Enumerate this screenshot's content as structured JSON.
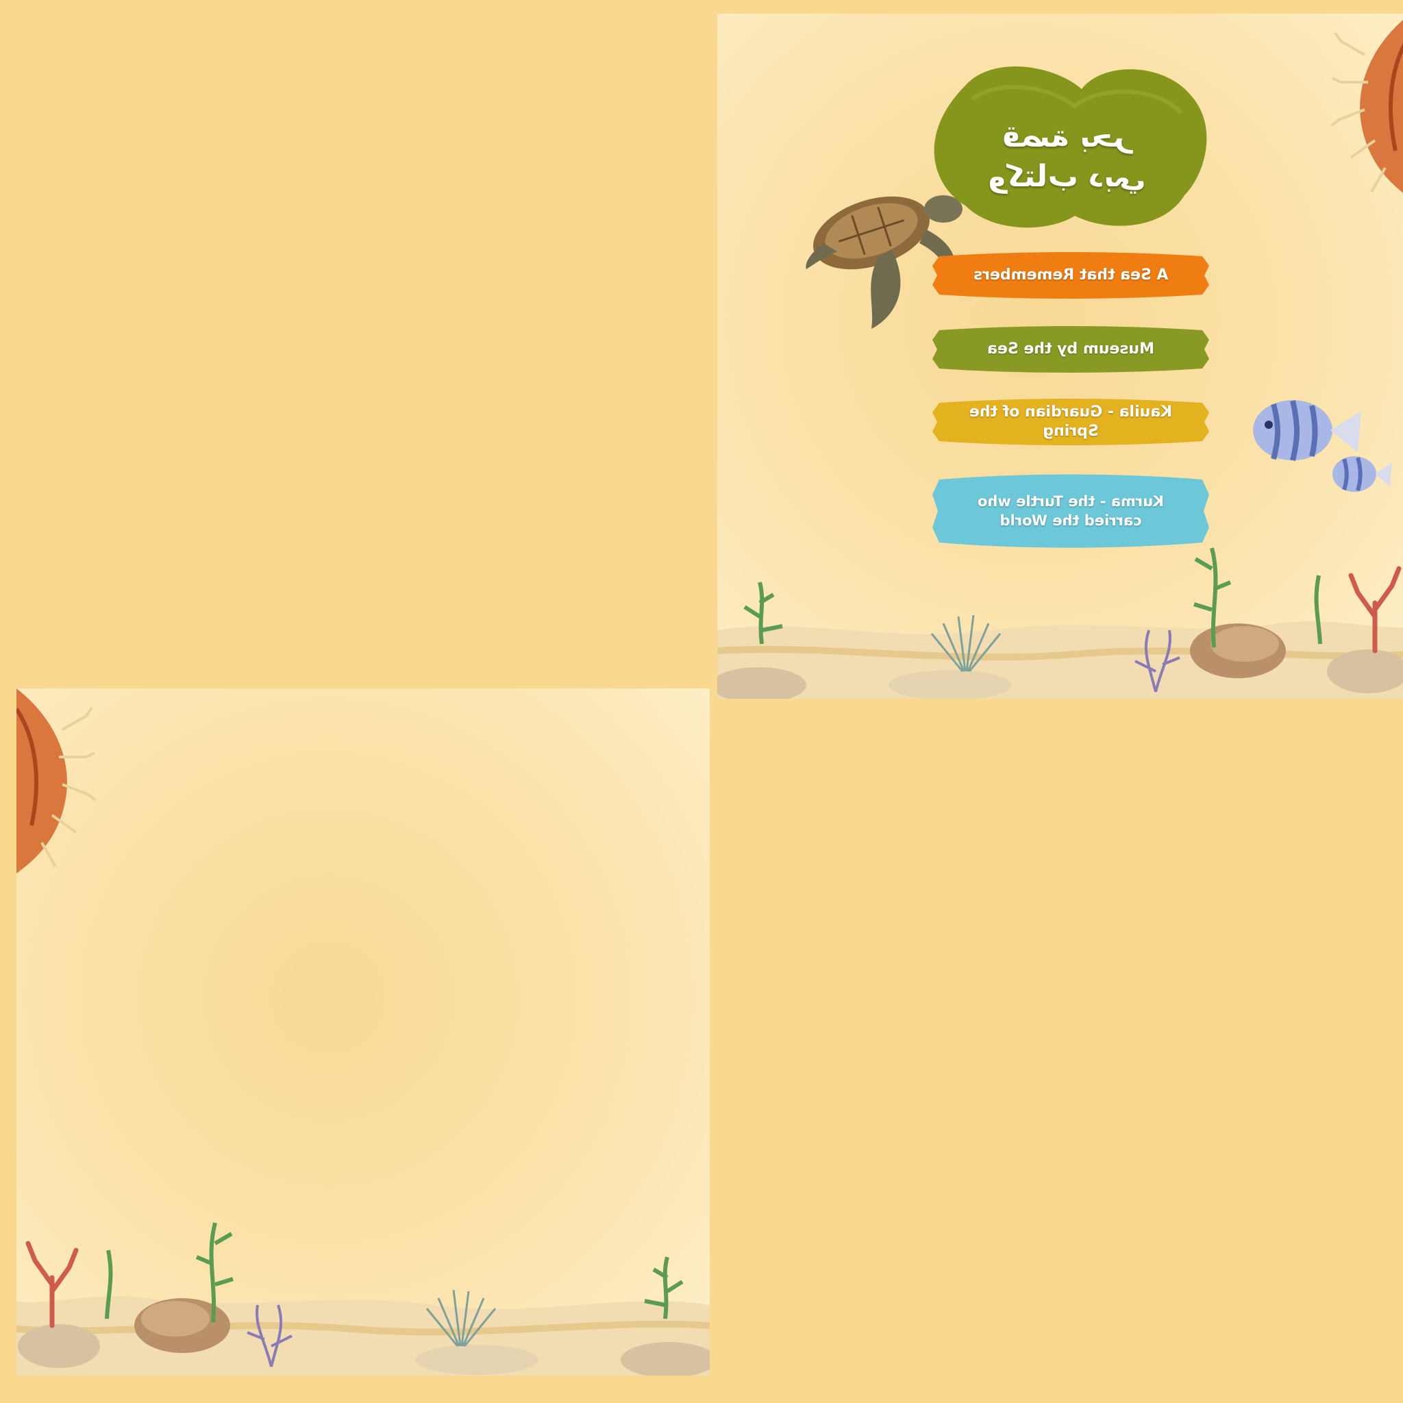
{
  "title_cloud": {
    "line1": "قصة بحر",
    "line2": "وكتاب دبي",
    "color": "#86961c"
  },
  "menu": [
    {
      "label": "A Sea that Remembers",
      "color": "#ef7d12"
    },
    {
      "label": "Museum by the Sea",
      "color": "#889a24"
    },
    {
      "label": "Kauila - Guardian of the Spring",
      "color": "#e4b11f"
    },
    {
      "label": "Kurma - the Turtle who carried the World",
      "color": "#6cc8d8"
    }
  ],
  "colors": {
    "background": "#f9d98f",
    "page": "#fbe3ac",
    "sand": "#f2dcb2",
    "coral": "#d96e3a"
  }
}
